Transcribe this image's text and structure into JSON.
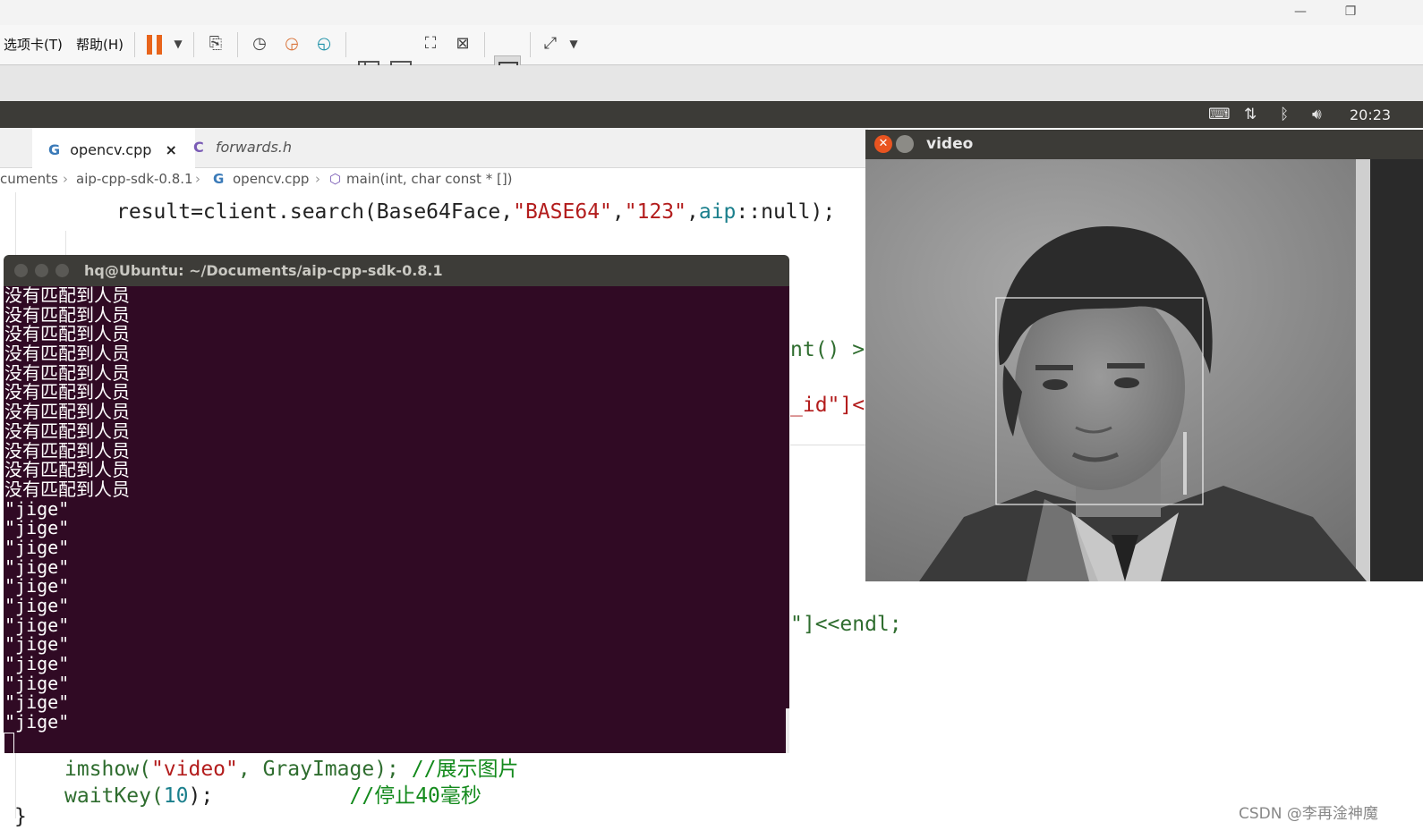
{
  "host": {
    "menu_tabs": "选项卡(T)",
    "menu_help": "帮助(H)",
    "minimize": "—",
    "restore": "❐"
  },
  "panel": {
    "clock": "20:23"
  },
  "ide": {
    "tabs": [
      {
        "label": "opencv.cpp",
        "close": "×"
      },
      {
        "label": "forwards.h"
      }
    ],
    "breadcrumb": [
      "cuments",
      "aip-cpp-sdk-0.8.1",
      "opencv.cpp",
      "main(int, char const * [])"
    ],
    "code_line1": {
      "a": "result=client.search(Base64Face,",
      "s1": "\"BASE64\"",
      "c1": ",",
      "s2": "\"123\"",
      "c2": ",",
      "ns": "aip",
      "rest": "::null);"
    },
    "peek1": "nt() >",
    "peek2": "_id\"]<<",
    "peek3": "\"]<<endl;",
    "code_line2": {
      "fn": "imshow(",
      "s": "\"video\"",
      "rest": ", GrayImage);",
      "cm": "//展示图片"
    },
    "code_line3": {
      "fn": "waitKey(",
      "n": "10",
      "rest": ");",
      "cm": "//停止40毫秒"
    },
    "closing_brace": "}"
  },
  "terminal": {
    "title": "hq@Ubuntu: ~/Documents/aip-cpp-sdk-0.8.1",
    "lines": [
      "没有匹配到人员",
      "没有匹配到人员",
      "没有匹配到人员",
      "没有匹配到人员",
      "没有匹配到人员",
      "没有匹配到人员",
      "没有匹配到人员",
      "没有匹配到人员",
      "没有匹配到人员",
      "没有匹配到人员",
      "没有匹配到人员",
      "\"jige\"",
      "\"jige\"",
      "\"jige\"",
      "\"jige\"",
      "\"jige\"",
      "\"jige\"",
      "\"jige\"",
      "\"jige\"",
      "\"jige\"",
      "\"jige\"",
      "\"jige\"",
      "\"jige\""
    ]
  },
  "video_window": {
    "title": "video"
  },
  "watermark": "CSDN @李再淦神魔"
}
